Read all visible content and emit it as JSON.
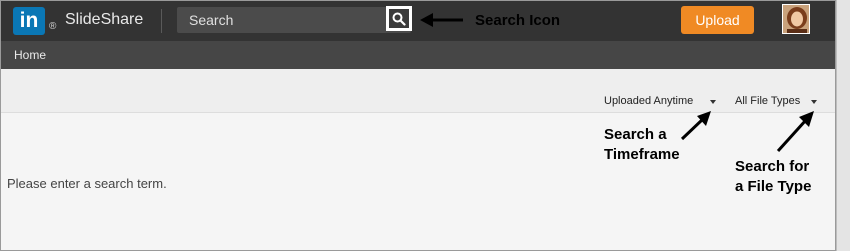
{
  "app": {
    "logo_text": "in",
    "logo_reg": "®",
    "brand": "SlideShare"
  },
  "search": {
    "placeholder": "Search"
  },
  "header": {
    "upload_label": "Upload"
  },
  "nav": {
    "home_label": "Home"
  },
  "filters": {
    "timeframe_label": "Uploaded Anytime",
    "filetype_label": "All File Types"
  },
  "content": {
    "message": "Please enter a search term."
  },
  "annotations": {
    "search_icon": "Search Icon",
    "timeframe_line1": "Search a",
    "timeframe_line2": "Timeframe",
    "filetype_line1": "Search for",
    "filetype_line2": "a File Type"
  },
  "colors": {
    "topbar": "#333333",
    "subnav": "#464646",
    "logo": "#0a77b5",
    "upload": "#f08a24"
  },
  "icons": {
    "search": "magnifier-icon",
    "caret": "caret-down-icon",
    "arrow": "arrow-icon"
  }
}
